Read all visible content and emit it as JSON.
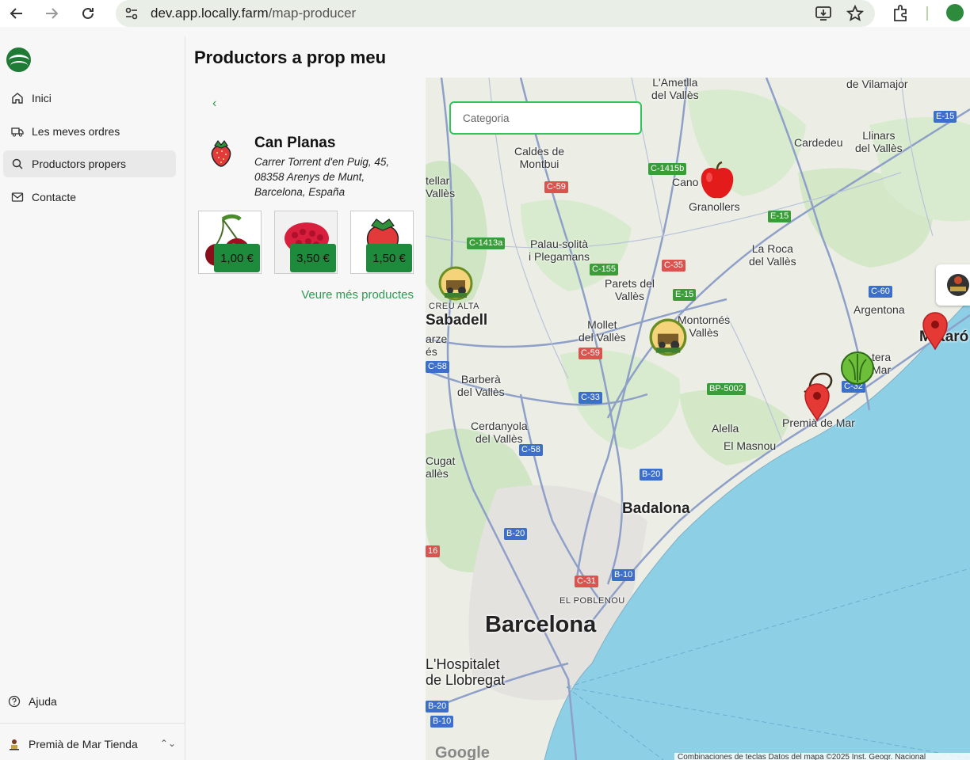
{
  "browser": {
    "url_host": "dev.app.locally.farm",
    "url_path": "/map-producer"
  },
  "sidebar": {
    "items": [
      {
        "label": "Inici",
        "icon": "home-icon"
      },
      {
        "label": "Les meves ordres",
        "icon": "truck-icon"
      },
      {
        "label": "Productors propers",
        "icon": "search-icon",
        "active": true
      },
      {
        "label": "Contacte",
        "icon": "mail-icon"
      }
    ],
    "help_label": "Ajuda",
    "store_label": "Premià de Mar Tienda"
  },
  "page": {
    "title": "Productors a prop meu"
  },
  "producer": {
    "name": "Can Planas",
    "address": "Carrer Torrent d'en Puig, 45, 08358 Arenys de Munt, Barcelona, España",
    "products": [
      {
        "name": "cherries",
        "price": "1,00 €"
      },
      {
        "name": "raspberries",
        "price": "3,50 €"
      },
      {
        "name": "strawberry",
        "price": "1,50 €"
      }
    ],
    "more_link": "Veure més productes"
  },
  "map": {
    "category_placeholder": "Categoria",
    "places": {
      "ametlla": "L'Ametlla\ndel Vallès",
      "vilamajor": "de Vilamajor",
      "caldes": "Caldes de\nMontbui",
      "llinars": "Llinars\ndel Vallès",
      "cardedeu": "Cardedeu",
      "tellar": "tellar\nVallès",
      "canov": "Cano",
      "granollers": "Granollers",
      "palau": "Palau-solità\ni Plegamans",
      "laroca": "La Roca\ndel Vallès",
      "parets": "Parets del\nVallès",
      "creu": "CREU ALTA",
      "sabadell": "Sabadell",
      "argentona": "Argentona",
      "mollet": "Mollet\ndel Vallès",
      "montornes": "Montornés\nVallès",
      "mataro": "Mataró",
      "arze": "arze\nés",
      "barbera": "Barberà\ndel Vallès",
      "vilassar": "tera\nMar",
      "premia": "Premià de Mar",
      "alella": "Alella",
      "masnou": "El Masnou",
      "cerdanyola": "Cerdanyola\ndel Vallès",
      "cugat": "Cugat\nallès",
      "badalona": "Badalona",
      "poblenou": "EL POBLENOU",
      "barcelona": "Barcelona",
      "hospitalet": "L'Hospitalet\nde Llobregat"
    },
    "roads": [
      "C-1415b",
      "C-59",
      "E-15",
      "C-1413a",
      "C-155",
      "C-35",
      "E-15",
      "C-60",
      "C-59",
      "C-58",
      "BP-5002",
      "C-32",
      "C-33",
      "C-58",
      "B-20",
      "B-20",
      "C-31",
      "B-10",
      "16",
      "B-20",
      "B-10",
      "E-15"
    ],
    "google_label": "Google",
    "attribution": "Combinaciones de teclas   Datos del mapa ©2025 Inst. Geogr. Nacional"
  },
  "colors": {
    "accent": "#2e9a52",
    "price_bg": "#1e8a3c",
    "water": "#8dd0e6",
    "marker_red": "#d93025"
  }
}
